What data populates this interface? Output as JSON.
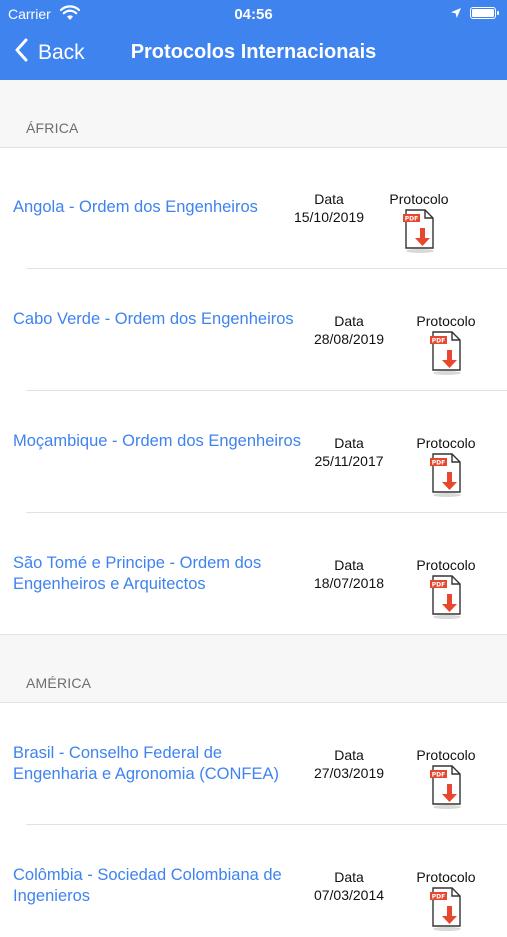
{
  "status_bar": {
    "carrier": "Carrier",
    "time": "04:56"
  },
  "nav": {
    "back_label": "Back",
    "title": "Protocolos Internacionais"
  },
  "sections": [
    {
      "name": "ÁFRICA"
    },
    {
      "name": "AMÉRICA"
    }
  ],
  "rows": [
    {
      "name": "Angola - Ordem dos Engenheiros",
      "date_label": "Data",
      "date": "15/10/2019",
      "protocol_label": "Protocolo",
      "icon": "pdf-download-icon"
    },
    {
      "name": "Cabo Verde - Ordem dos Engenheiros",
      "date_label": "Data",
      "date": "28/08/2019",
      "protocol_label": "Protocolo",
      "icon": "pdf-download-icon"
    },
    {
      "name": "Moçambique - Ordem dos Engenheiros",
      "date_label": "Data",
      "date": "25/11/2017",
      "protocol_label": "Protocolo",
      "icon": "pdf-download-icon"
    },
    {
      "name": "São Tomé e Principe - Ordem dos Engenheiros e Arquitectos",
      "date_label": "Data",
      "date": "18/07/2018",
      "protocol_label": "Protocolo",
      "icon": "pdf-download-icon"
    },
    {
      "name": "Brasil - Conselho Federal de Engenharia e Agronomia (CONFEA)",
      "date_label": "Data",
      "date": "27/03/2019",
      "protocol_label": "Protocolo",
      "icon": "pdf-download-icon"
    },
    {
      "name": "Colômbia - Sociedad Colombiana de Ingenieros",
      "date_label": "Data",
      "date": "07/03/2014",
      "protocol_label": "Protocolo",
      "icon": "pdf-download-icon"
    }
  ],
  "colors": {
    "accent": "#3f83ef",
    "pdf_red": "#e8472f"
  }
}
